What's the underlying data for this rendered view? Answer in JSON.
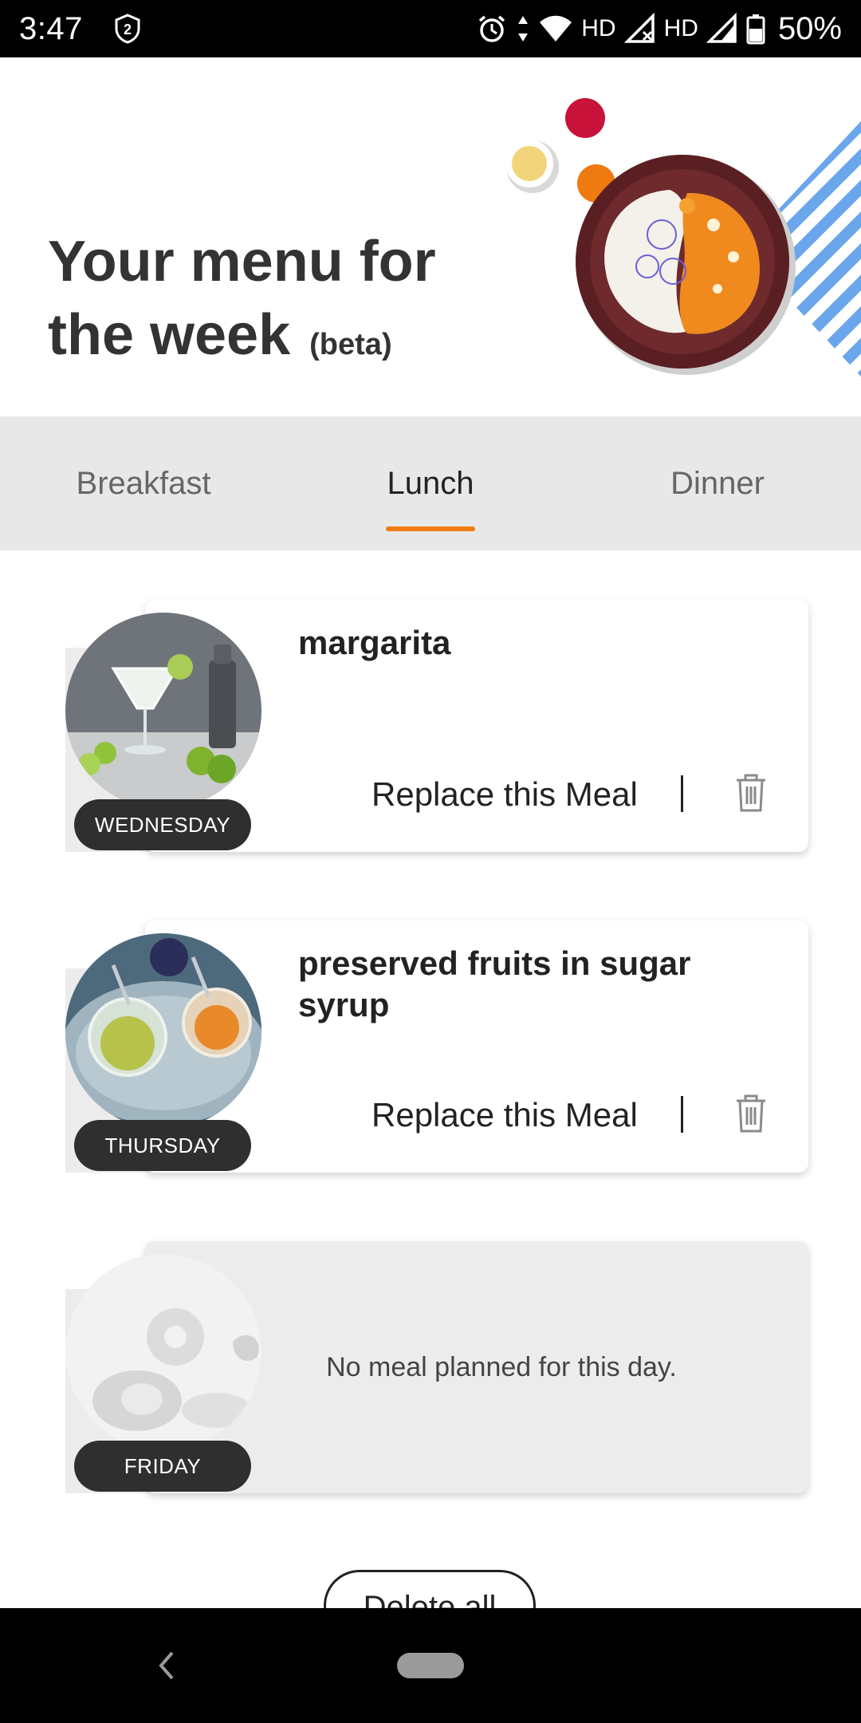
{
  "status_bar": {
    "time": "3:47",
    "network_label_1": "HD",
    "network_label_2": "HD",
    "battery": "50%",
    "icons": [
      "shield-2-icon",
      "alarm-icon",
      "data-arrows-icon",
      "wifi-icon",
      "signal-x-icon",
      "signal-icon",
      "battery-icon"
    ]
  },
  "header": {
    "title": "Your menu for the week",
    "title_line1": "Your menu for",
    "title_line2": "the week",
    "beta": "(beta)"
  },
  "tabs": [
    {
      "label": "Breakfast",
      "active": false
    },
    {
      "label": "Lunch",
      "active": true
    },
    {
      "label": "Dinner",
      "active": false
    }
  ],
  "accent_color": "#f07c12",
  "meals": [
    {
      "day": "WEDNESDAY",
      "title": "margarita",
      "replace_label": "Replace this Meal"
    },
    {
      "day": "THURSDAY",
      "title": "preserved fruits in sugar syrup",
      "replace_label": "Replace this Meal"
    },
    {
      "day": "FRIDAY",
      "empty_text": "No meal planned for this day."
    }
  ],
  "delete_all_label": "Delete all"
}
